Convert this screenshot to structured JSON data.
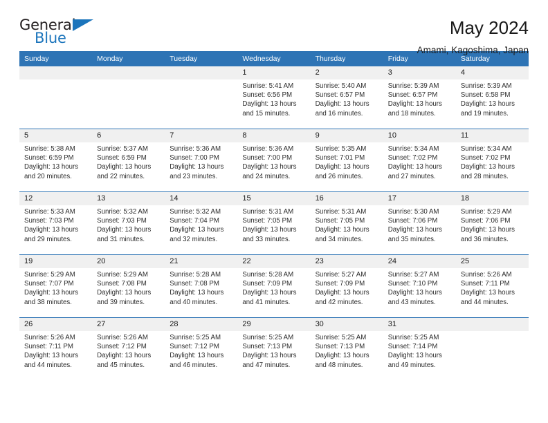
{
  "brand": {
    "name_top": "General",
    "name_bottom": "Blue",
    "triangle_color": "#1c75bc",
    "text_color": "#231f20"
  },
  "header": {
    "month_title": "May 2024",
    "location": "Amami, Kagoshima, Japan"
  },
  "calendar": {
    "header_bg": "#2e74b5",
    "daynum_bg": "#f0f0f0",
    "weekday_headers": [
      "Sunday",
      "Monday",
      "Tuesday",
      "Wednesday",
      "Thursday",
      "Friday",
      "Saturday"
    ],
    "labels": {
      "sunrise": "Sunrise:",
      "sunset": "Sunset:",
      "daylight": "Daylight:"
    },
    "weeks": [
      [
        {
          "day": ""
        },
        {
          "day": ""
        },
        {
          "day": ""
        },
        {
          "day": "1",
          "sunrise": "Sunrise: 5:41 AM",
          "sunset": "Sunset: 6:56 PM",
          "daylight_l1": "Daylight: 13 hours",
          "daylight_l2": "and 15 minutes."
        },
        {
          "day": "2",
          "sunrise": "Sunrise: 5:40 AM",
          "sunset": "Sunset: 6:57 PM",
          "daylight_l1": "Daylight: 13 hours",
          "daylight_l2": "and 16 minutes."
        },
        {
          "day": "3",
          "sunrise": "Sunrise: 5:39 AM",
          "sunset": "Sunset: 6:57 PM",
          "daylight_l1": "Daylight: 13 hours",
          "daylight_l2": "and 18 minutes."
        },
        {
          "day": "4",
          "sunrise": "Sunrise: 5:39 AM",
          "sunset": "Sunset: 6:58 PM",
          "daylight_l1": "Daylight: 13 hours",
          "daylight_l2": "and 19 minutes."
        }
      ],
      [
        {
          "day": "5",
          "sunrise": "Sunrise: 5:38 AM",
          "sunset": "Sunset: 6:59 PM",
          "daylight_l1": "Daylight: 13 hours",
          "daylight_l2": "and 20 minutes."
        },
        {
          "day": "6",
          "sunrise": "Sunrise: 5:37 AM",
          "sunset": "Sunset: 6:59 PM",
          "daylight_l1": "Daylight: 13 hours",
          "daylight_l2": "and 22 minutes."
        },
        {
          "day": "7",
          "sunrise": "Sunrise: 5:36 AM",
          "sunset": "Sunset: 7:00 PM",
          "daylight_l1": "Daylight: 13 hours",
          "daylight_l2": "and 23 minutes."
        },
        {
          "day": "8",
          "sunrise": "Sunrise: 5:36 AM",
          "sunset": "Sunset: 7:00 PM",
          "daylight_l1": "Daylight: 13 hours",
          "daylight_l2": "and 24 minutes."
        },
        {
          "day": "9",
          "sunrise": "Sunrise: 5:35 AM",
          "sunset": "Sunset: 7:01 PM",
          "daylight_l1": "Daylight: 13 hours",
          "daylight_l2": "and 26 minutes."
        },
        {
          "day": "10",
          "sunrise": "Sunrise: 5:34 AM",
          "sunset": "Sunset: 7:02 PM",
          "daylight_l1": "Daylight: 13 hours",
          "daylight_l2": "and 27 minutes."
        },
        {
          "day": "11",
          "sunrise": "Sunrise: 5:34 AM",
          "sunset": "Sunset: 7:02 PM",
          "daylight_l1": "Daylight: 13 hours",
          "daylight_l2": "and 28 minutes."
        }
      ],
      [
        {
          "day": "12",
          "sunrise": "Sunrise: 5:33 AM",
          "sunset": "Sunset: 7:03 PM",
          "daylight_l1": "Daylight: 13 hours",
          "daylight_l2": "and 29 minutes."
        },
        {
          "day": "13",
          "sunrise": "Sunrise: 5:32 AM",
          "sunset": "Sunset: 7:03 PM",
          "daylight_l1": "Daylight: 13 hours",
          "daylight_l2": "and 31 minutes."
        },
        {
          "day": "14",
          "sunrise": "Sunrise: 5:32 AM",
          "sunset": "Sunset: 7:04 PM",
          "daylight_l1": "Daylight: 13 hours",
          "daylight_l2": "and 32 minutes."
        },
        {
          "day": "15",
          "sunrise": "Sunrise: 5:31 AM",
          "sunset": "Sunset: 7:05 PM",
          "daylight_l1": "Daylight: 13 hours",
          "daylight_l2": "and 33 minutes."
        },
        {
          "day": "16",
          "sunrise": "Sunrise: 5:31 AM",
          "sunset": "Sunset: 7:05 PM",
          "daylight_l1": "Daylight: 13 hours",
          "daylight_l2": "and 34 minutes."
        },
        {
          "day": "17",
          "sunrise": "Sunrise: 5:30 AM",
          "sunset": "Sunset: 7:06 PM",
          "daylight_l1": "Daylight: 13 hours",
          "daylight_l2": "and 35 minutes."
        },
        {
          "day": "18",
          "sunrise": "Sunrise: 5:29 AM",
          "sunset": "Sunset: 7:06 PM",
          "daylight_l1": "Daylight: 13 hours",
          "daylight_l2": "and 36 minutes."
        }
      ],
      [
        {
          "day": "19",
          "sunrise": "Sunrise: 5:29 AM",
          "sunset": "Sunset: 7:07 PM",
          "daylight_l1": "Daylight: 13 hours",
          "daylight_l2": "and 38 minutes."
        },
        {
          "day": "20",
          "sunrise": "Sunrise: 5:29 AM",
          "sunset": "Sunset: 7:08 PM",
          "daylight_l1": "Daylight: 13 hours",
          "daylight_l2": "and 39 minutes."
        },
        {
          "day": "21",
          "sunrise": "Sunrise: 5:28 AM",
          "sunset": "Sunset: 7:08 PM",
          "daylight_l1": "Daylight: 13 hours",
          "daylight_l2": "and 40 minutes."
        },
        {
          "day": "22",
          "sunrise": "Sunrise: 5:28 AM",
          "sunset": "Sunset: 7:09 PM",
          "daylight_l1": "Daylight: 13 hours",
          "daylight_l2": "and 41 minutes."
        },
        {
          "day": "23",
          "sunrise": "Sunrise: 5:27 AM",
          "sunset": "Sunset: 7:09 PM",
          "daylight_l1": "Daylight: 13 hours",
          "daylight_l2": "and 42 minutes."
        },
        {
          "day": "24",
          "sunrise": "Sunrise: 5:27 AM",
          "sunset": "Sunset: 7:10 PM",
          "daylight_l1": "Daylight: 13 hours",
          "daylight_l2": "and 43 minutes."
        },
        {
          "day": "25",
          "sunrise": "Sunrise: 5:26 AM",
          "sunset": "Sunset: 7:11 PM",
          "daylight_l1": "Daylight: 13 hours",
          "daylight_l2": "and 44 minutes."
        }
      ],
      [
        {
          "day": "26",
          "sunrise": "Sunrise: 5:26 AM",
          "sunset": "Sunset: 7:11 PM",
          "daylight_l1": "Daylight: 13 hours",
          "daylight_l2": "and 44 minutes."
        },
        {
          "day": "27",
          "sunrise": "Sunrise: 5:26 AM",
          "sunset": "Sunset: 7:12 PM",
          "daylight_l1": "Daylight: 13 hours",
          "daylight_l2": "and 45 minutes."
        },
        {
          "day": "28",
          "sunrise": "Sunrise: 5:25 AM",
          "sunset": "Sunset: 7:12 PM",
          "daylight_l1": "Daylight: 13 hours",
          "daylight_l2": "and 46 minutes."
        },
        {
          "day": "29",
          "sunrise": "Sunrise: 5:25 AM",
          "sunset": "Sunset: 7:13 PM",
          "daylight_l1": "Daylight: 13 hours",
          "daylight_l2": "and 47 minutes."
        },
        {
          "day": "30",
          "sunrise": "Sunrise: 5:25 AM",
          "sunset": "Sunset: 7:13 PM",
          "daylight_l1": "Daylight: 13 hours",
          "daylight_l2": "and 48 minutes."
        },
        {
          "day": "31",
          "sunrise": "Sunrise: 5:25 AM",
          "sunset": "Sunset: 7:14 PM",
          "daylight_l1": "Daylight: 13 hours",
          "daylight_l2": "and 49 minutes."
        },
        {
          "day": ""
        }
      ]
    ]
  }
}
